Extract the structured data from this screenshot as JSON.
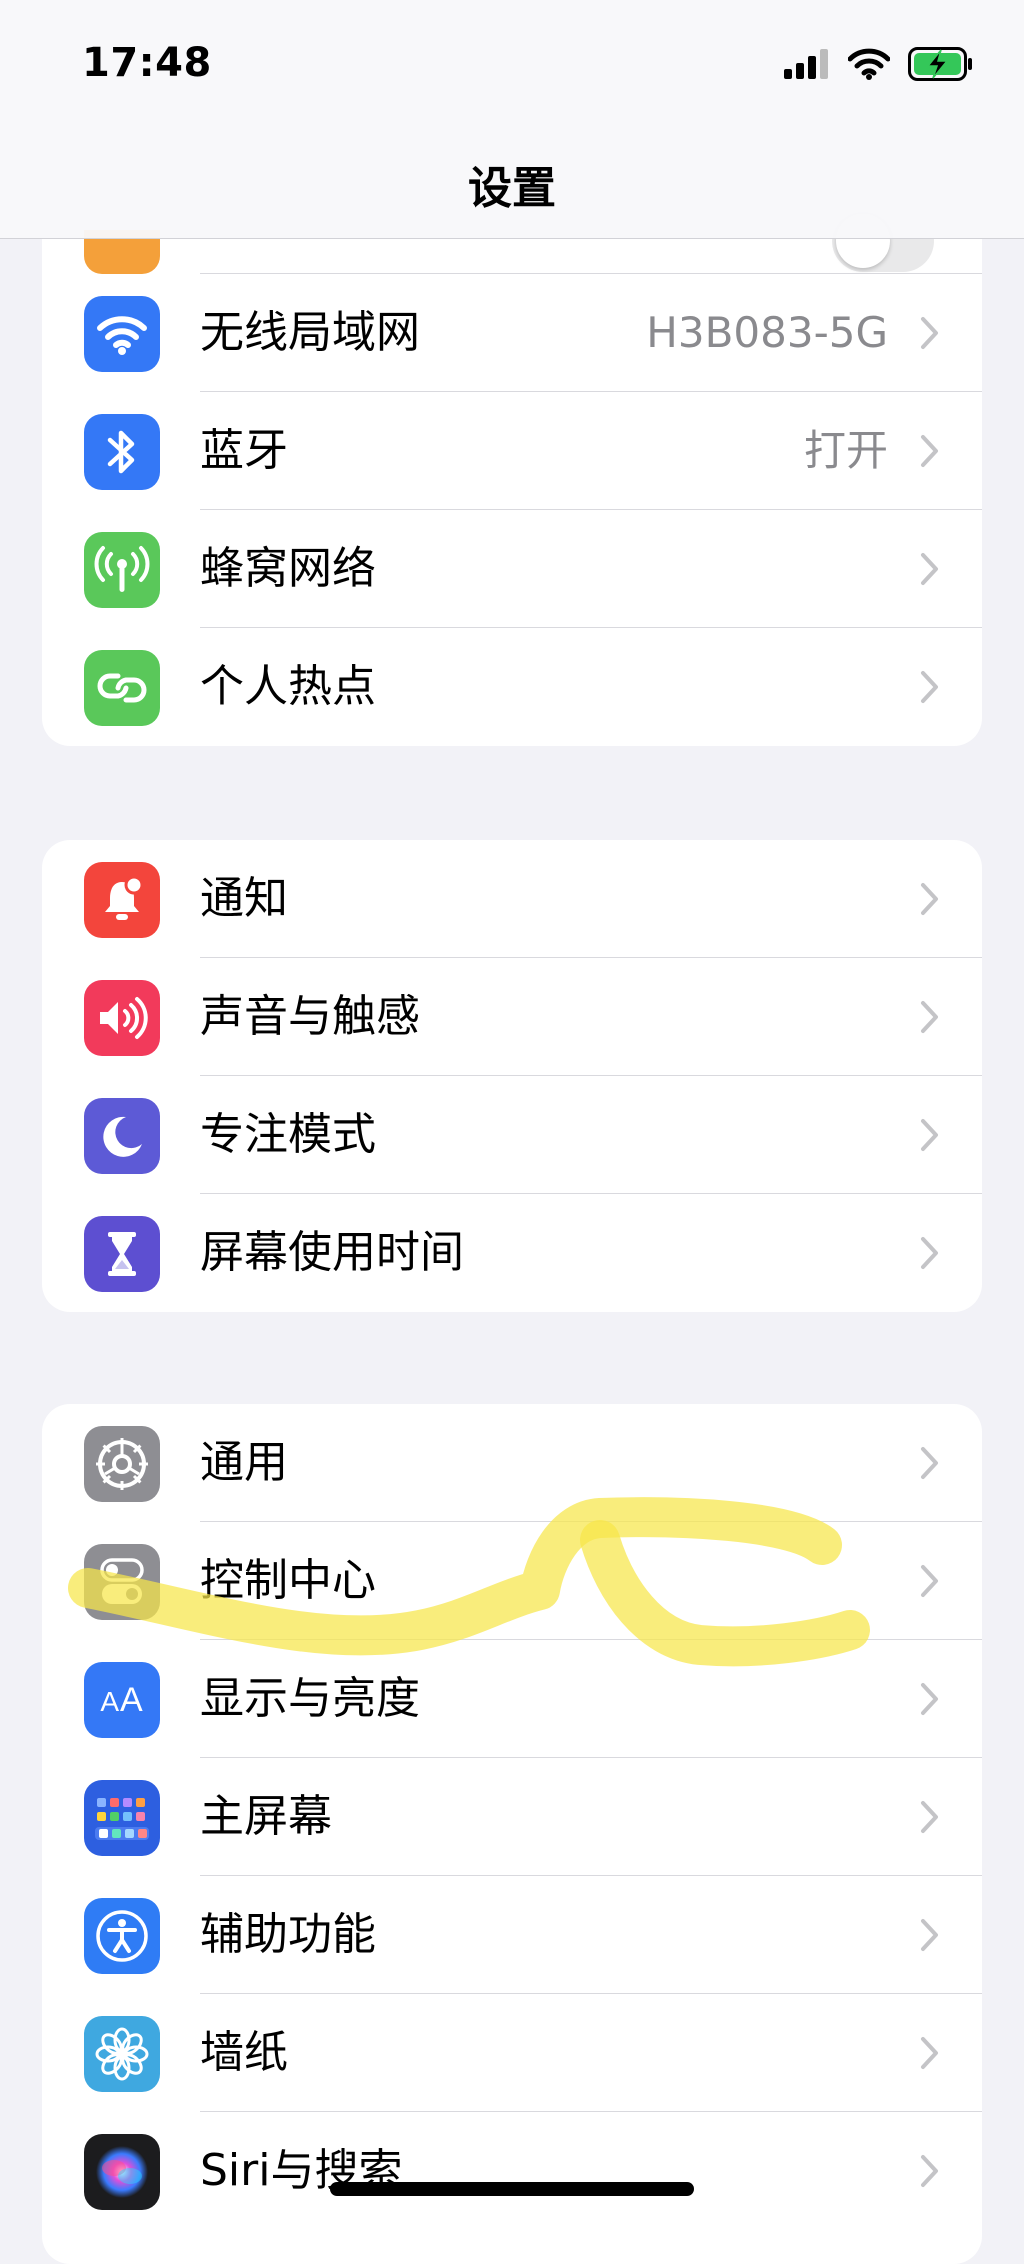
{
  "status_bar": {
    "time": "17:48",
    "icons": [
      "cellular-signal-icon",
      "wifi-icon",
      "battery-charging-icon"
    ]
  },
  "nav": {
    "title": "设置"
  },
  "groups": [
    {
      "rows": [
        {
          "label": "无线局域网",
          "value": "H3B083-5G",
          "icon": "wifi-icon",
          "color": "#3478f6"
        },
        {
          "label": "蓝牙",
          "value": "打开",
          "icon": "bluetooth-icon",
          "color": "#3478f6"
        },
        {
          "label": "蜂窝网络",
          "value": "",
          "icon": "antenna-icon",
          "color": "#5ac85a"
        },
        {
          "label": "个人热点",
          "value": "",
          "icon": "hotspot-link-icon",
          "color": "#5ac85a"
        }
      ]
    },
    {
      "rows": [
        {
          "label": "通知",
          "icon": "bell-icon",
          "color": "#f3453c"
        },
        {
          "label": "声音与触感",
          "icon": "speaker-icon",
          "color": "#f23a5b"
        },
        {
          "label": "专注模式",
          "icon": "moon-icon",
          "color": "#5d5ad6"
        },
        {
          "label": "屏幕使用时间",
          "icon": "hourglass-icon",
          "color": "#5d4fd1"
        }
      ]
    },
    {
      "rows": [
        {
          "label": "通用",
          "icon": "gear-icon",
          "color": "#8e8e93"
        },
        {
          "label": "控制中心",
          "icon": "toggles-icon",
          "color": "#8e8e93"
        },
        {
          "label": "显示与亮度",
          "icon": "text-size-icon",
          "color": "#3478f6"
        },
        {
          "label": "主屏幕",
          "icon": "home-screen-grid-icon",
          "color": "#2d5fe0"
        },
        {
          "label": "辅助功能",
          "icon": "accessibility-icon",
          "color": "#2f7cf5"
        },
        {
          "label": "墙纸",
          "icon": "flower-icon",
          "color": "#3fa8e0"
        },
        {
          "label": "Siri与搜索",
          "icon": "siri-icon",
          "color": "#1c1c1e"
        }
      ]
    }
  ],
  "colors": {
    "background": "#f2f2f7",
    "chevron": "#c4c4c7",
    "highlighter": "#f7e64a"
  }
}
